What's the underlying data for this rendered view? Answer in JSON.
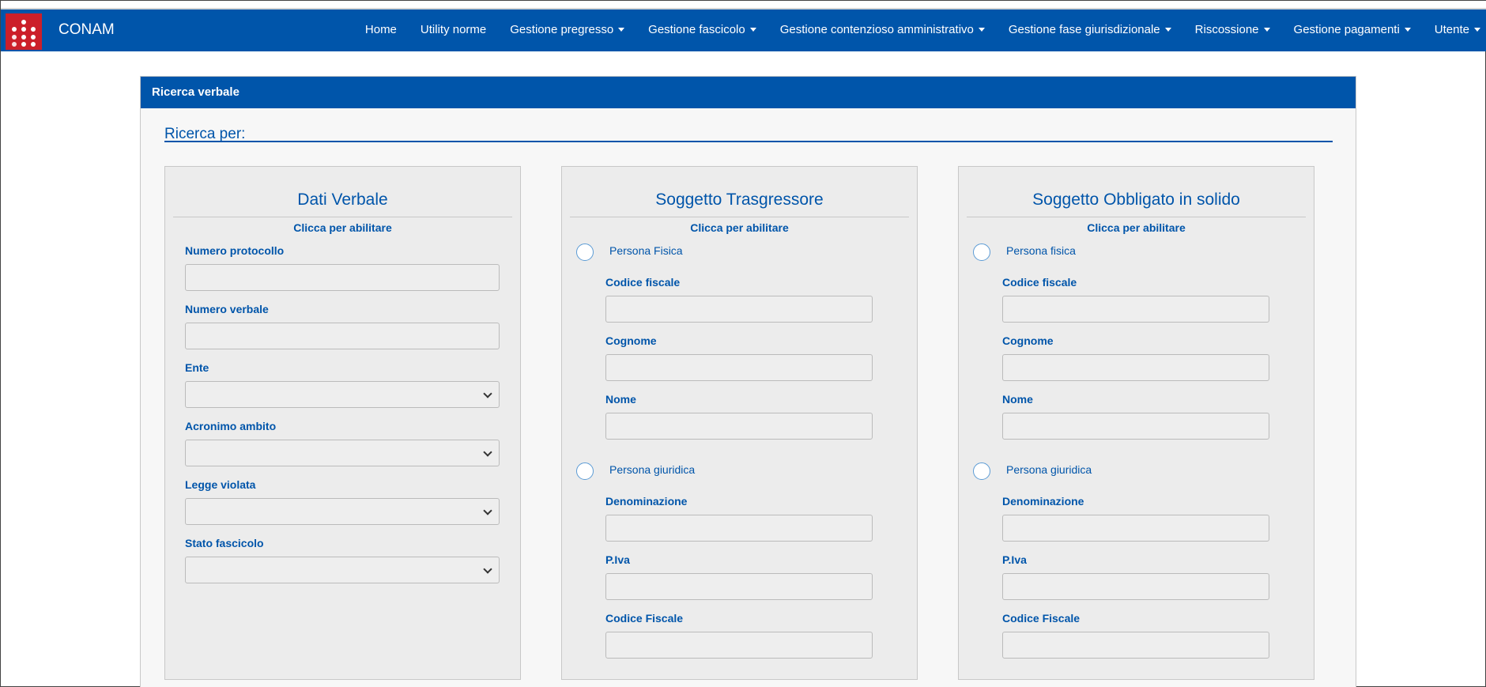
{
  "app": {
    "brand": "CONAM"
  },
  "nav": {
    "items": [
      {
        "label": "Home",
        "caret": false
      },
      {
        "label": "Utility norme",
        "caret": false
      },
      {
        "label": "Gestione pregresso",
        "caret": true
      },
      {
        "label": "Gestione fascicolo",
        "caret": true
      },
      {
        "label": "Gestione contenzioso amministrativo",
        "caret": true
      },
      {
        "label": "Gestione fase giurisdizionale",
        "caret": true
      },
      {
        "label": "Riscossione",
        "caret": true
      },
      {
        "label": "Gestione pagamenti",
        "caret": true
      },
      {
        "label": "Utente",
        "caret": true
      }
    ]
  },
  "panel": {
    "heading": "Ricerca verbale",
    "search_for": "Ricerca per:"
  },
  "dati_verbale": {
    "title": "Dati Verbale",
    "subtitle": "Clicca per abilitare",
    "numero_protocollo": {
      "label": "Numero protocollo",
      "value": ""
    },
    "numero_verbale": {
      "label": "Numero verbale",
      "value": ""
    },
    "ente": {
      "label": "Ente",
      "value": ""
    },
    "acronimo_ambito": {
      "label": "Acronimo ambito",
      "value": ""
    },
    "legge_violata": {
      "label": "Legge violata",
      "value": ""
    },
    "stato_fascicolo": {
      "label": "Stato fascicolo",
      "value": ""
    }
  },
  "trasgressore": {
    "title": "Soggetto Trasgressore",
    "subtitle": "Clicca per abilitare",
    "persona_fisica": "Persona Fisica",
    "codice_fiscale": {
      "label": "Codice fiscale",
      "value": ""
    },
    "cognome": {
      "label": "Cognome",
      "value": ""
    },
    "nome": {
      "label": "Nome",
      "value": ""
    },
    "persona_giuridica": "Persona giuridica",
    "denominazione": {
      "label": "Denominazione",
      "value": ""
    },
    "piva": {
      "label": "P.Iva",
      "value": ""
    },
    "codice_fiscale_pg": {
      "label": "Codice Fiscale",
      "value": ""
    }
  },
  "obbligato": {
    "title": "Soggetto Obbligato in solido",
    "subtitle": "Clicca per abilitare",
    "persona_fisica": "Persona fisica",
    "codice_fiscale": {
      "label": "Codice fiscale",
      "value": ""
    },
    "cognome": {
      "label": "Cognome",
      "value": ""
    },
    "nome": {
      "label": "Nome",
      "value": ""
    },
    "persona_giuridica": "Persona giuridica",
    "denominazione": {
      "label": "Denominazione",
      "value": ""
    },
    "piva": {
      "label": "P.Iva",
      "value": ""
    },
    "codice_fiscale_pg": {
      "label": "Codice Fiscale",
      "value": ""
    }
  },
  "colors": {
    "brand": "#0055aa",
    "logo": "#cc1f2a",
    "radio": "#5b9bd5"
  }
}
